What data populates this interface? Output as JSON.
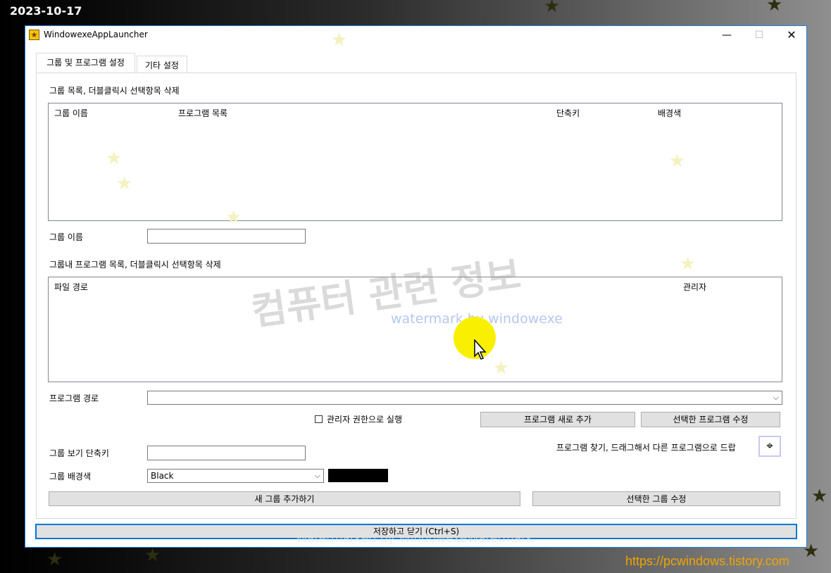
{
  "overlay": {
    "date": "2023-10-17",
    "site_url": "https://pcwindows.tistory.com",
    "watermark_korean": "컴퓨터 관련 정보",
    "watermark_english": "watermark by windowexe",
    "watermark_bottom": "Watermarked by WindowexeWatermark"
  },
  "window": {
    "title": "WindowexeAppLauncher",
    "minimize_glyph": "—",
    "maximize_glyph": "☐",
    "close_glyph": "✕"
  },
  "tabs": [
    {
      "label": "그룹 및 프로그램 설정",
      "active": true
    },
    {
      "label": "기타 설정",
      "active": false
    }
  ],
  "group_list": {
    "caption": "그룹 목록, 더블클릭시 선택항목 삭제",
    "columns": [
      "그룹 이름",
      "프로그램 목록",
      "단축키",
      "배경색"
    ]
  },
  "group_name": {
    "label": "그룹 이름",
    "value": ""
  },
  "program_list": {
    "caption": "그룹내 프로그램 목록, 더블클릭시 선택항목 삭제",
    "columns": [
      "파일 경로",
      "관리자"
    ]
  },
  "program_path": {
    "label": "프로그램 경로",
    "value": ""
  },
  "run_as_admin": {
    "label": "관리자 권한으로 실행",
    "checked": false
  },
  "buttons": {
    "add_program": "프로그램 새로 추가",
    "edit_program": "선택한 프로그램 수정",
    "add_group": "새 그룹 추가하기",
    "edit_group": "선택한 그룹 수정",
    "save_close": "저장하고 닫기 (Ctrl+S)"
  },
  "find_program": {
    "label": "프로그램 찾기, 드래그해서 다른 프로그램으로 드랍",
    "icon": "crosshair-icon"
  },
  "shortcut": {
    "label": "그룹 보기 단축키",
    "value": ""
  },
  "background_color": {
    "label": "그룹 배경색",
    "selected": "Black",
    "swatch_color": "#000000"
  },
  "colors": {
    "accent": "#0078d7",
    "window_border": "#1a7ee6",
    "cursor_highlight": "#f8f000",
    "url": "#f0a500"
  }
}
